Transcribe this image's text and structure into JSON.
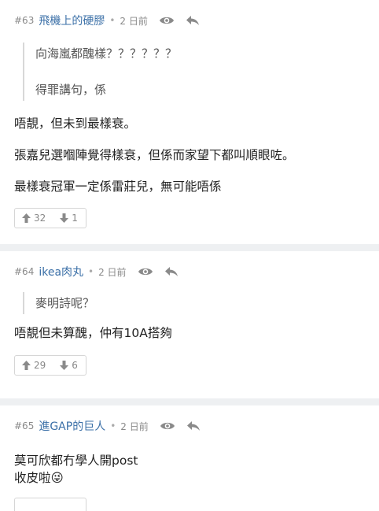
{
  "posts": [
    {
      "num": "#63",
      "user": "飛機上的硬膠",
      "time": "2 日前",
      "quote_lines": [
        "向海嵐都醜樣？？？？？？",
        "得罪講句，係"
      ],
      "body_lines": [
        "唔靚，但未到最樣衰。",
        "張嘉兒選嗰陣覺得樣衰，但係而家望下都叫順眼咗。",
        "最樣衰冠軍一定係雷莊兒，無可能唔係"
      ],
      "likes": "32",
      "dislikes": "1"
    },
    {
      "num": "#64",
      "user": "ikea肉丸",
      "time": "2 日前",
      "quote_lines": [
        "麥明詩呢？"
      ],
      "body_lines": [
        "唔靚但未算醜，仲有10A搭夠"
      ],
      "likes": "29",
      "dislikes": "6"
    },
    {
      "num": "#65",
      "user": "進GAP的巨人",
      "time": "2 日前",
      "body_lines": [
        "莫可欣都冇學人開post",
        "收皮啦😜"
      ]
    }
  ],
  "icons": {
    "view": "eye-icon",
    "reply": "reply-arrow-icon",
    "up": "thumb-up-arrow-icon",
    "down": "thumb-down-arrow-icon"
  },
  "colors": {
    "username": "#3a6fa7",
    "separator": "#eef0f2",
    "icon": "#8a8a8a"
  }
}
